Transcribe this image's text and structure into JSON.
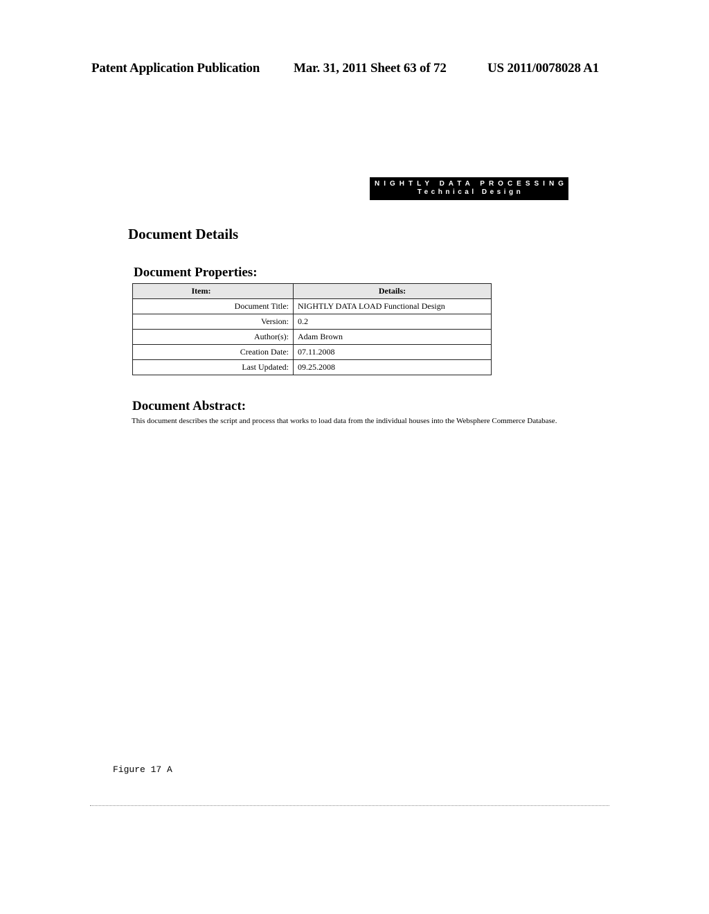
{
  "header": {
    "publication": "Patent Application Publication",
    "date_sheet": "Mar. 31, 2011  Sheet 63 of 72",
    "patent_number": "US 2011/0078028 A1"
  },
  "banner": {
    "line1": "NIGHTLY DATA PROCESSING",
    "line2": "Technical Design"
  },
  "document_details": {
    "title": "Document Details",
    "properties_title": "Document Properties:",
    "table": {
      "headers": [
        "Item:",
        "Details:"
      ],
      "rows": [
        {
          "item": "Document Title:",
          "detail": "NIGHTLY DATA LOAD Functional Design"
        },
        {
          "item": "Version:",
          "detail": "0.2"
        },
        {
          "item": "Author(s):",
          "detail": "Adam Brown"
        },
        {
          "item": "Creation Date:",
          "detail": "07.11.2008"
        },
        {
          "item": "Last Updated:",
          "detail": "09.25.2008"
        }
      ]
    },
    "abstract_title": "Document Abstract:",
    "abstract_text": "This document describes the script and process that works to load data from the individual houses into the Websphere Commerce Database."
  },
  "figure_label": "Figure 17 A"
}
